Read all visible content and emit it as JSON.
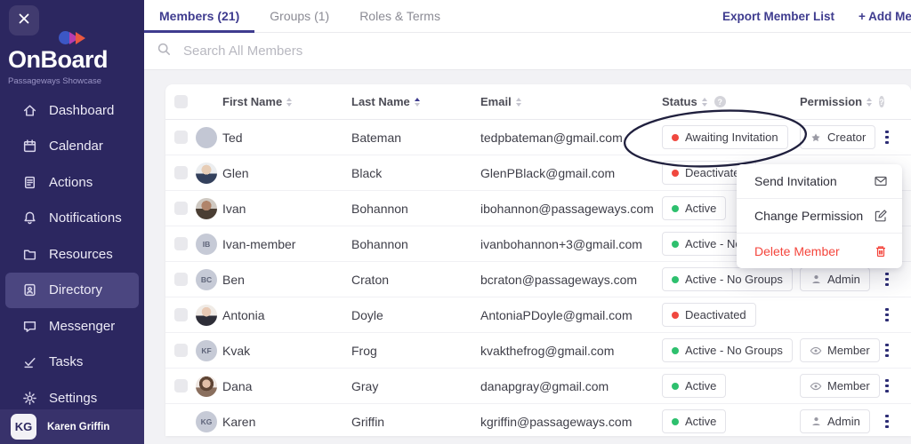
{
  "brand": {
    "app_name": "OnBoard",
    "workspace": "Passageways Showcase"
  },
  "sidebar": {
    "items": [
      {
        "label": "Dashboard",
        "icon": "home-icon",
        "active": false
      },
      {
        "label": "Calendar",
        "icon": "calendar-icon",
        "active": false
      },
      {
        "label": "Actions",
        "icon": "document-icon",
        "active": false
      },
      {
        "label": "Notifications",
        "icon": "bell-icon",
        "active": false
      },
      {
        "label": "Resources",
        "icon": "folder-icon",
        "active": false
      },
      {
        "label": "Directory",
        "icon": "id-badge-icon",
        "active": true
      },
      {
        "label": "Messenger",
        "icon": "chat-icon",
        "active": false
      },
      {
        "label": "Tasks",
        "icon": "check-icon",
        "active": false
      },
      {
        "label": "Settings",
        "icon": "gear-icon",
        "active": false
      }
    ],
    "user": {
      "initials": "KG",
      "name": "Karen Griffin"
    }
  },
  "tabs": [
    {
      "label": "Members (21)",
      "active": true
    },
    {
      "label": "Groups (1)",
      "active": false
    },
    {
      "label": "Roles & Terms",
      "active": false
    }
  ],
  "header_actions": [
    {
      "label": "Export Member List"
    },
    {
      "label": "+ Add Member"
    }
  ],
  "search": {
    "placeholder": "Search All Members"
  },
  "table": {
    "columns": [
      "First Name",
      "Last Name",
      "Email",
      "Status",
      "Permission"
    ],
    "sorted_column": "Last Name",
    "sort_direction": "ascending",
    "rows": [
      {
        "first_name": "Ted",
        "last_name": "Bateman",
        "email": "tedpbateman@gmail.com",
        "status": {
          "label": "Awaiting Invitation",
          "color": "red"
        },
        "permission": {
          "label": "Creator",
          "icon": "creator-icon"
        },
        "avatar": {
          "type": "blank"
        },
        "checkbox": true
      },
      {
        "first_name": "Glen",
        "last_name": "Black",
        "email": "GlenPBlack@gmail.com",
        "status": {
          "label": "Deactivated",
          "color": "red"
        },
        "permission": null,
        "avatar": {
          "type": "photo",
          "variant": "man-suit"
        },
        "checkbox": true
      },
      {
        "first_name": "Ivan",
        "last_name": "Bohannon",
        "email": "ibohannon@passageways.com",
        "status": {
          "label": "Active",
          "color": "green"
        },
        "permission": null,
        "avatar": {
          "type": "photo",
          "variant": "man-beard"
        },
        "checkbox": true
      },
      {
        "first_name": "Ivan-member",
        "last_name": "Bohannon",
        "email": "ivanbohannon+3@gmail.com",
        "status": {
          "label": "Active - No Groups",
          "color": "green"
        },
        "permission": null,
        "avatar": {
          "type": "initials",
          "initials": "IB"
        },
        "checkbox": true
      },
      {
        "first_name": "Ben",
        "last_name": "Craton",
        "email": "bcraton@passageways.com",
        "status": {
          "label": "Active - No Groups",
          "color": "green"
        },
        "permission": {
          "label": "Admin",
          "icon": "admin-icon"
        },
        "avatar": {
          "type": "initials",
          "initials": "BC"
        },
        "checkbox": true
      },
      {
        "first_name": "Antonia",
        "last_name": "Doyle",
        "email": "AntoniaPDoyle@gmail.com",
        "status": {
          "label": "Deactivated",
          "color": "red"
        },
        "permission": null,
        "avatar": {
          "type": "photo",
          "variant": "woman-dark"
        },
        "checkbox": true
      },
      {
        "first_name": "Kvak",
        "last_name": "Frog",
        "email": "kvakthefrog@gmail.com",
        "status": {
          "label": "Active - No Groups",
          "color": "green"
        },
        "permission": {
          "label": "Member",
          "icon": "member-icon"
        },
        "avatar": {
          "type": "initials",
          "initials": "KF"
        },
        "checkbox": true
      },
      {
        "first_name": "Dana",
        "last_name": "Gray",
        "email": "danapgray@gmail.com",
        "status": {
          "label": "Active",
          "color": "green"
        },
        "permission": {
          "label": "Member",
          "icon": "member-icon"
        },
        "avatar": {
          "type": "photo",
          "variant": "woman-hair"
        },
        "checkbox": true
      },
      {
        "first_name": "Karen",
        "last_name": "Griffin",
        "email": "kgriffin@passageways.com",
        "status": {
          "label": "Active",
          "color": "green"
        },
        "permission": {
          "label": "Admin",
          "icon": "admin-icon"
        },
        "avatar": {
          "type": "initials",
          "initials": "KG"
        },
        "checkbox": false
      }
    ]
  },
  "context_menu": {
    "items": [
      {
        "label": "Send Invitation",
        "icon": "envelope-icon",
        "danger": false
      },
      {
        "label": "Change Permission",
        "icon": "edit-icon",
        "danger": false
      },
      {
        "label": "Delete Member",
        "icon": "trash-icon",
        "danger": true
      }
    ]
  },
  "annotation": {
    "shape": "ellipse",
    "around": "Awaiting Invitation status badge on Ted Bateman row",
    "color": "#20203e"
  },
  "colors": {
    "accent": "#3f3c8f",
    "sidebar_bg": "#2c2760",
    "status_active": "#2ec06e",
    "status_inactive": "#f0483f",
    "danger": "#f4453c"
  }
}
